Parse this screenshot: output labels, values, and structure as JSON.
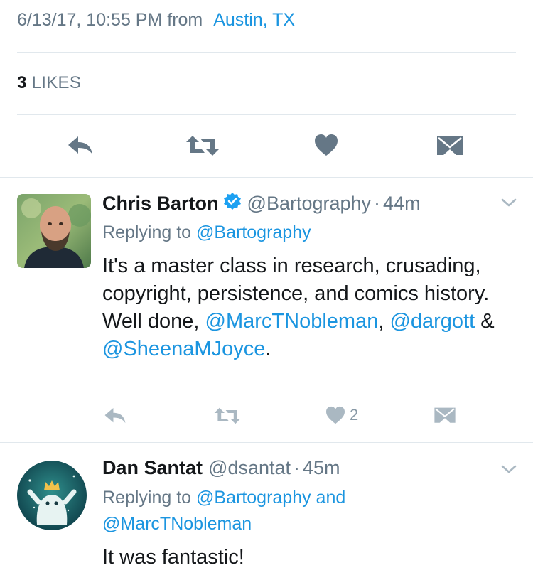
{
  "detail": {
    "timestamp": "6/13/17, 10:55 PM from",
    "location": "Austin, TX",
    "likes_count": "3",
    "likes_label": "LIKES"
  },
  "tweets": [
    {
      "name": "Chris Barton",
      "verified": true,
      "handle": "@Bartography",
      "time": "44m",
      "reply_prefix": "Replying to",
      "reply_to": "@Bartography",
      "text_1": "It's a master class in research, crusading, copyright, persistence, and comics history. Well done, ",
      "mention_1": "@MarcTNobleman",
      "sep_1": ", ",
      "mention_2": "@dargott",
      "sep_2": " & ",
      "mention_3": "@SheenaMJoyce",
      "text_end": ".",
      "like_count": "2"
    },
    {
      "name": "Dan Santat",
      "handle": "@dsantat",
      "time": "45m",
      "reply_prefix": "Replying to",
      "reply_to": "@Bartography and @MarcTNobleman",
      "text": "It was fantastic!"
    }
  ],
  "icons": {
    "reply": "reply-icon",
    "retweet": "retweet-icon",
    "like": "heart-icon",
    "dm": "envelope-icon",
    "menu": "chevron-down-icon",
    "verified": "verified-badge-icon"
  },
  "colors": {
    "link": "#1b95e0",
    "secondary_text": "#657786",
    "icon_gray": "#aab8c2",
    "icon_dark": "#657786",
    "divider": "#e1e8ed",
    "verified": "#1da1f2"
  }
}
